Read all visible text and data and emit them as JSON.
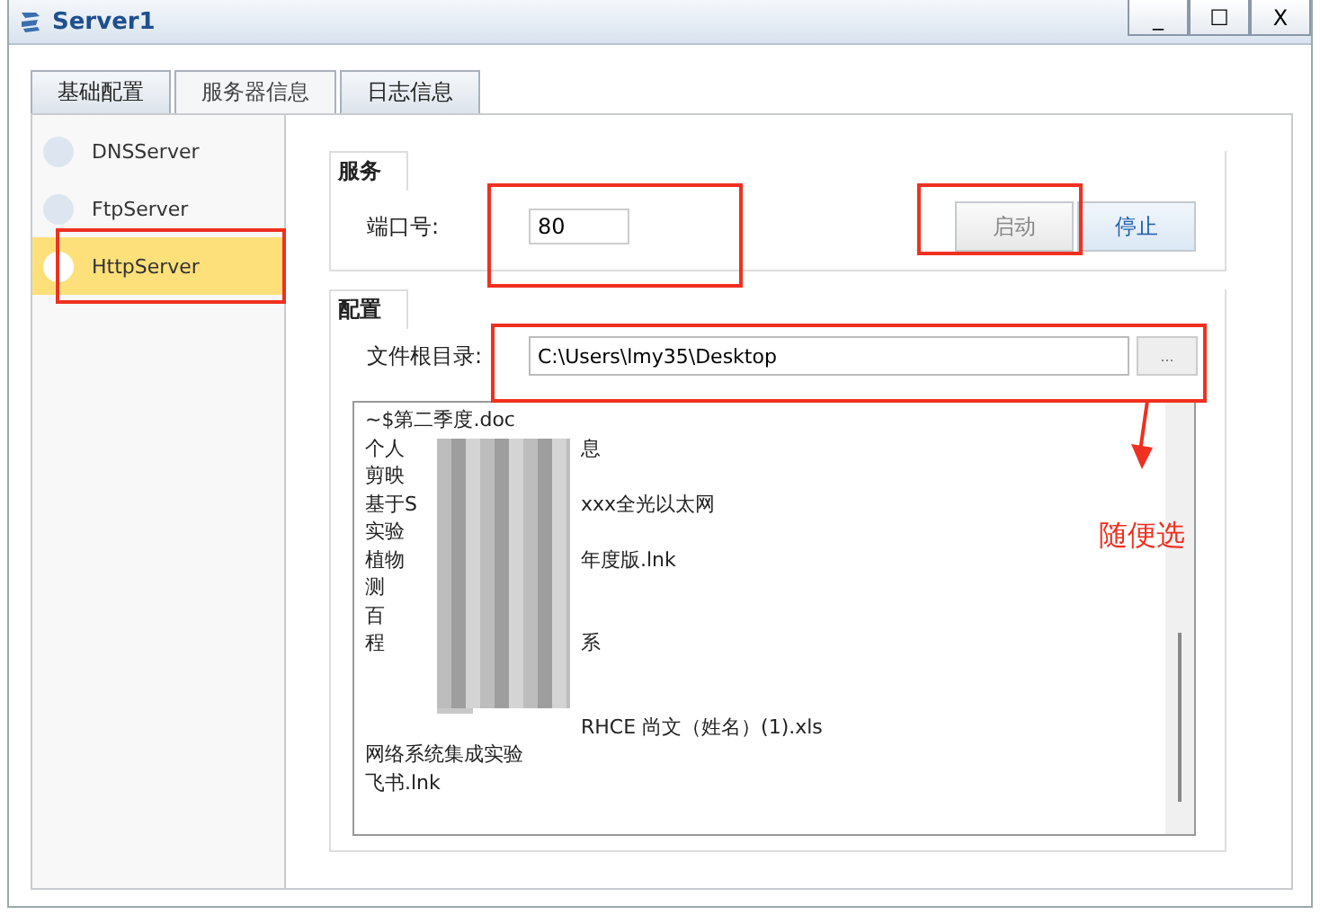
{
  "window": {
    "title": "Server1",
    "controls": [
      "_",
      "☐",
      "X"
    ]
  },
  "tabs": [
    {
      "label": "基础配置",
      "selected": false
    },
    {
      "label": "服务器信息",
      "selected": true
    },
    {
      "label": "日志信息",
      "selected": false
    }
  ],
  "servers": [
    {
      "label": "DNSServer",
      "selected": false
    },
    {
      "label": "FtpServer",
      "selected": false
    },
    {
      "label": "HttpServer",
      "selected": true
    }
  ],
  "service": {
    "title": "服务",
    "port_label": "端口号:",
    "port_value": "80",
    "start_button": {
      "label": "启动",
      "disabled": true
    },
    "stop_button": {
      "label": "停止",
      "disabled": false
    }
  },
  "config": {
    "title": "配置",
    "root_label": "文件根目录:",
    "root_value": "C:\\Users\\lmy35\\Desktop",
    "browse_button": "...",
    "files": [
      {
        "text": "~$第二季度.doc"
      },
      {
        "text": "个人",
        "tail": "息"
      },
      {
        "text": "剪映"
      },
      {
        "text": "基于S",
        "tail": "xxx全光以太网"
      },
      {
        "text": "实验"
      },
      {
        "text": "植物",
        "tail": "年度版.lnk"
      },
      {
        "text": "测"
      },
      {
        "text": "百"
      },
      {
        "text": "程",
        "tail": "系"
      },
      {
        "kind": "redacted"
      },
      {
        "kind": "redacted"
      },
      {
        "tail": "RHCE 尚文（姓名）(1).xls"
      },
      {
        "text": "网络系统集成实验"
      },
      {
        "text": "飞书.lnk"
      }
    ]
  },
  "annotation": {
    "note": "随便选"
  }
}
